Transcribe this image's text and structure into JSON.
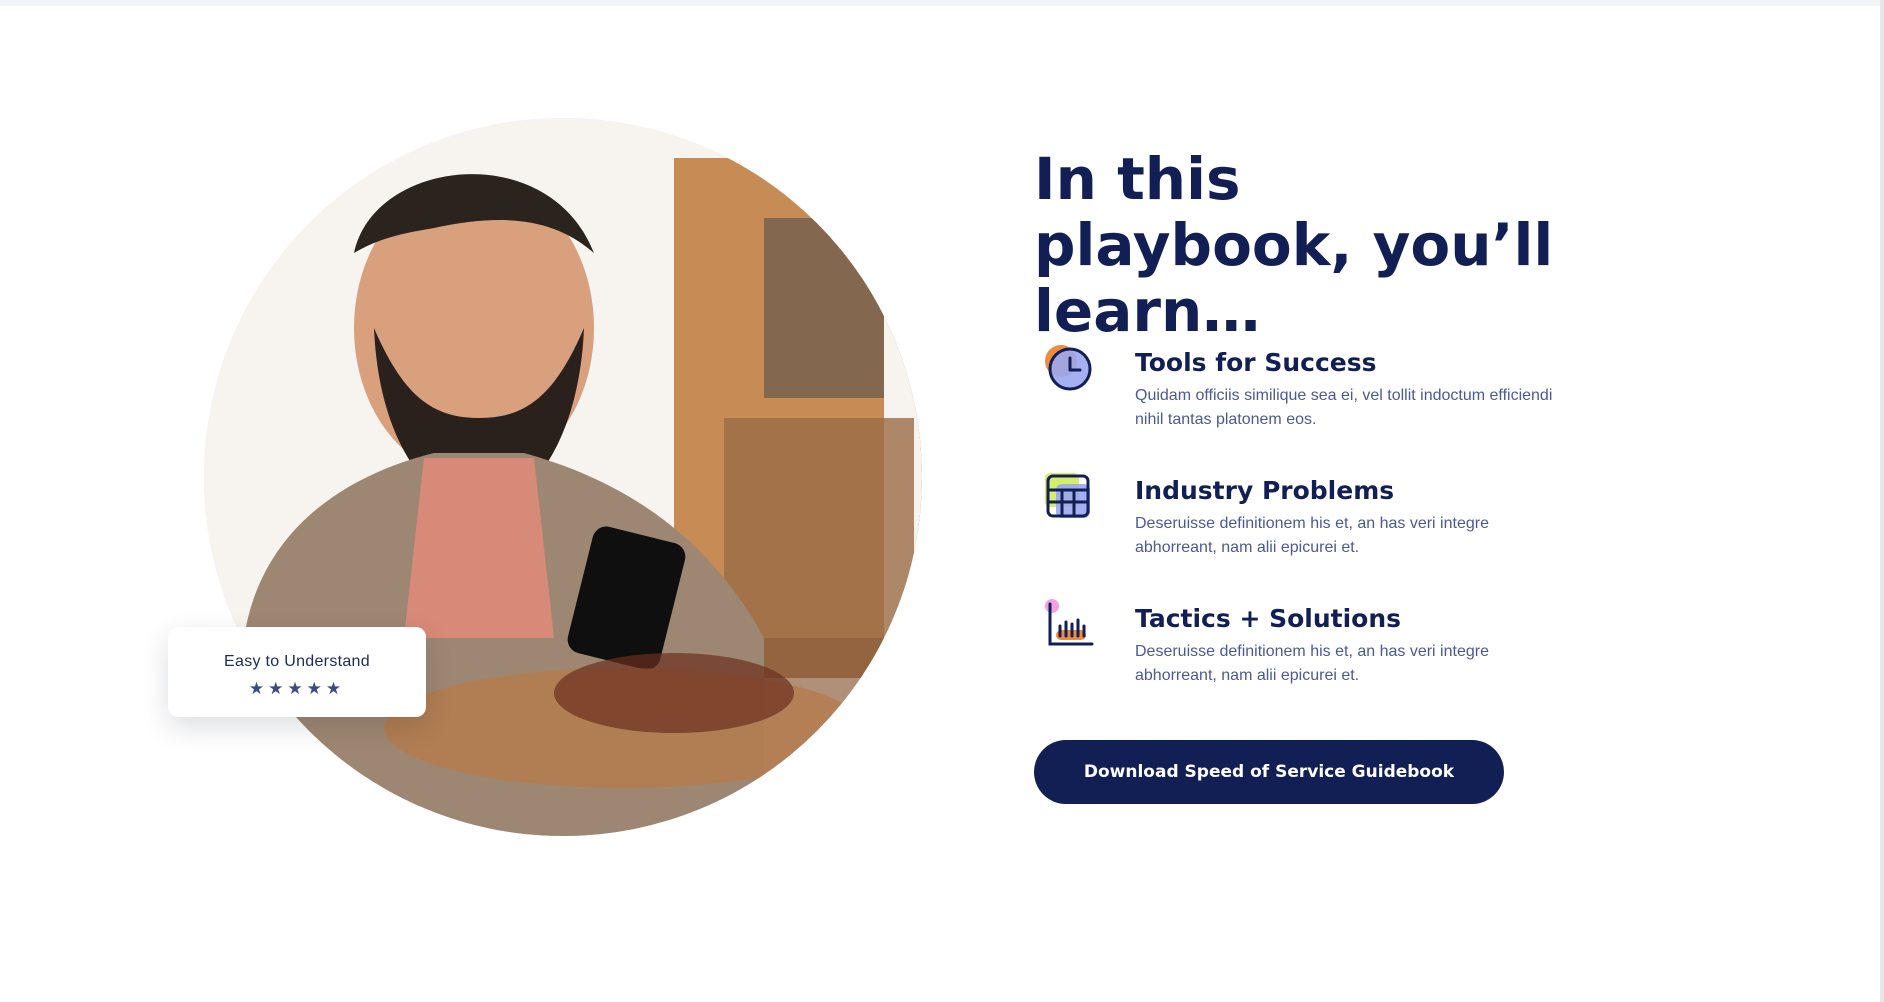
{
  "hero": {
    "badge": {
      "label": "Easy to Understand",
      "stars": "★★★★★"
    },
    "image_subject": "man-using-phone-at-cafe"
  },
  "content": {
    "headline": "In this playbook, you’ll learn…",
    "features": [
      {
        "icon": "clock-icon",
        "title": "Tools for Success",
        "description": "Quidam officiis similique sea ei, vel tollit indoctum efficiendi nihil tantas platonem eos."
      },
      {
        "icon": "grid-table-icon",
        "title": "Industry Problems",
        "description": "Deseruisse definitionem his et, an has veri integre abhorreant, nam alii epicurei et."
      },
      {
        "icon": "bar-chart-icon",
        "title": "Tactics + Solutions",
        "description": "Deseruisse definitionem his et, an has veri integre abhorreant, nam alii epicurei et."
      }
    ],
    "cta_label": "Download Speed of Service Guidebook"
  },
  "colors": {
    "navy": "#111f55",
    "text_muted": "#4b5a91",
    "accent_orange": "#f08a3c",
    "accent_purple": "#9aa7f0",
    "accent_lime": "#d5ee67",
    "accent_pink": "#f2a2e2"
  }
}
